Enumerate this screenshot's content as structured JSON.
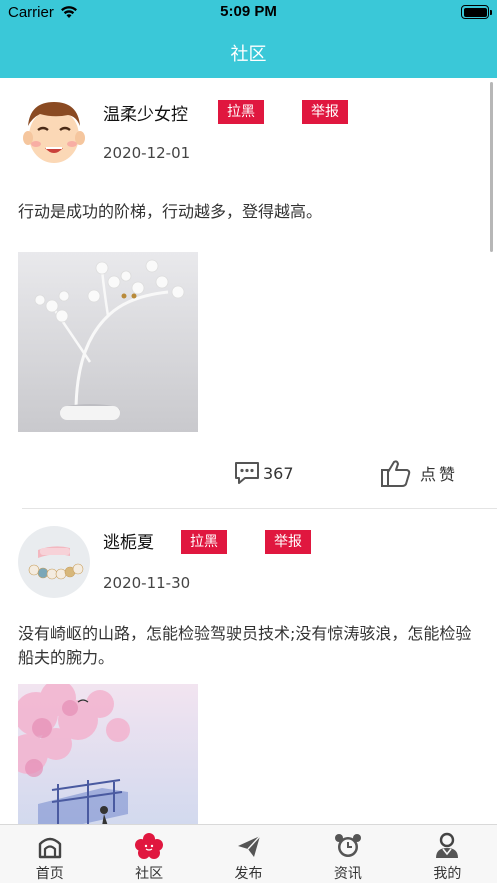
{
  "status_bar": {
    "carrier": "Carrier",
    "time": "5:09 PM"
  },
  "nav": {
    "title": "社区"
  },
  "posts": [
    {
      "username": "温柔少女控",
      "block_label": "拉黑",
      "report_label": "举报",
      "date": "2020-12-01",
      "text": "行动是成功的阶梯，行动越多，登得越高。",
      "comment_count": "367",
      "like_label": "点赞"
    },
    {
      "username": "逃栀夏",
      "block_label": "拉黑",
      "report_label": "举报",
      "date": "2020-11-30",
      "text": "没有崎岖的山路，怎能检验驾驶员技术;没有惊涛骇浪，怎能检验船夫的腕力。"
    }
  ],
  "tabs": [
    {
      "label": "首页",
      "icon": "home-icon"
    },
    {
      "label": "社区",
      "icon": "community-icon",
      "active": true
    },
    {
      "label": "发布",
      "icon": "send-icon"
    },
    {
      "label": "资讯",
      "icon": "alarm-clock-icon"
    },
    {
      "label": "我的",
      "icon": "user-icon"
    }
  ],
  "colors": {
    "header": "#3ac8d8",
    "tag": "#e0173f",
    "active_tab": "#e0173f"
  }
}
